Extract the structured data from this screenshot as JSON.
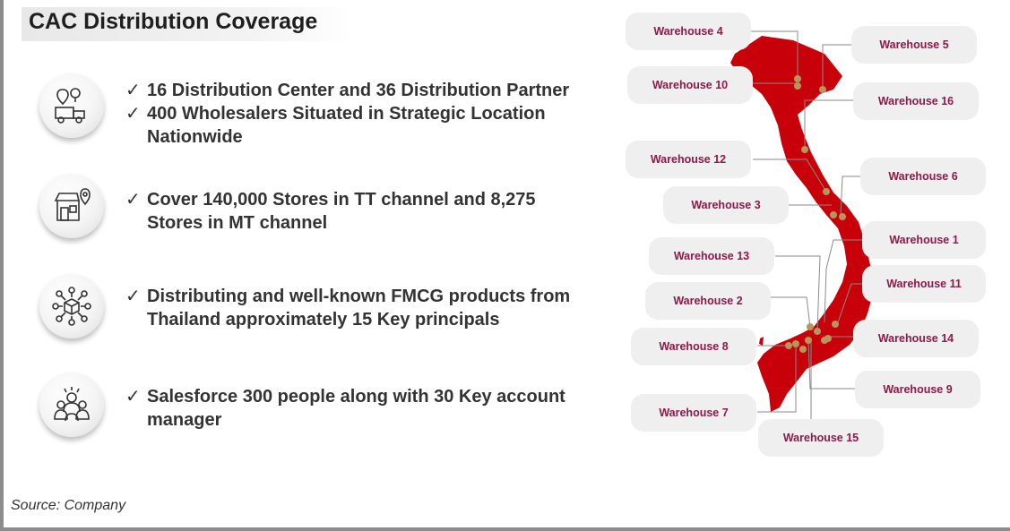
{
  "title": "CAC Distribution Coverage",
  "features": [
    {
      "icon": "delivery-truck-location-icon",
      "lines": [
        "16 Distribution Center and 36 Distribution Partner",
        "400 Wholesalers Situated in Strategic Location"
      ],
      "continuation": "Nationwide"
    },
    {
      "icon": "store-location-icon",
      "lines": [
        "Cover 140,000 Stores in TT channel and  8,275"
      ],
      "continuation": "Stores in MT channel"
    },
    {
      "icon": "product-network-icon",
      "lines": [
        "Distributing and well-known FMCG products from"
      ],
      "continuation": "Thailand approximately 15 Key principals"
    },
    {
      "icon": "salesforce-team-icon",
      "lines": [
        "Salesforce 300 people along with 30 Key account"
      ],
      "continuation": "manager"
    }
  ],
  "warehouses": {
    "w4": "Warehouse 4",
    "w5": "Warehouse 5",
    "w10": "Warehouse 10",
    "w16": "Warehouse 16",
    "w12": "Warehouse 12",
    "w6": "Warehouse 6",
    "w3": "Warehouse 3",
    "w1": "Warehouse 1",
    "w13": "Warehouse 13",
    "w11": "Warehouse 11",
    "w2": "Warehouse 2",
    "w8": "Warehouse 8",
    "w14": "Warehouse 14",
    "w9": "Warehouse 9",
    "w7": "Warehouse 7",
    "w15": "Warehouse 15"
  },
  "colors": {
    "map_fill": "#c8000a",
    "marker": "#b8955a",
    "label_text": "#8b1a4a",
    "label_bg": "#efefef"
  },
  "source": "Source: Company"
}
